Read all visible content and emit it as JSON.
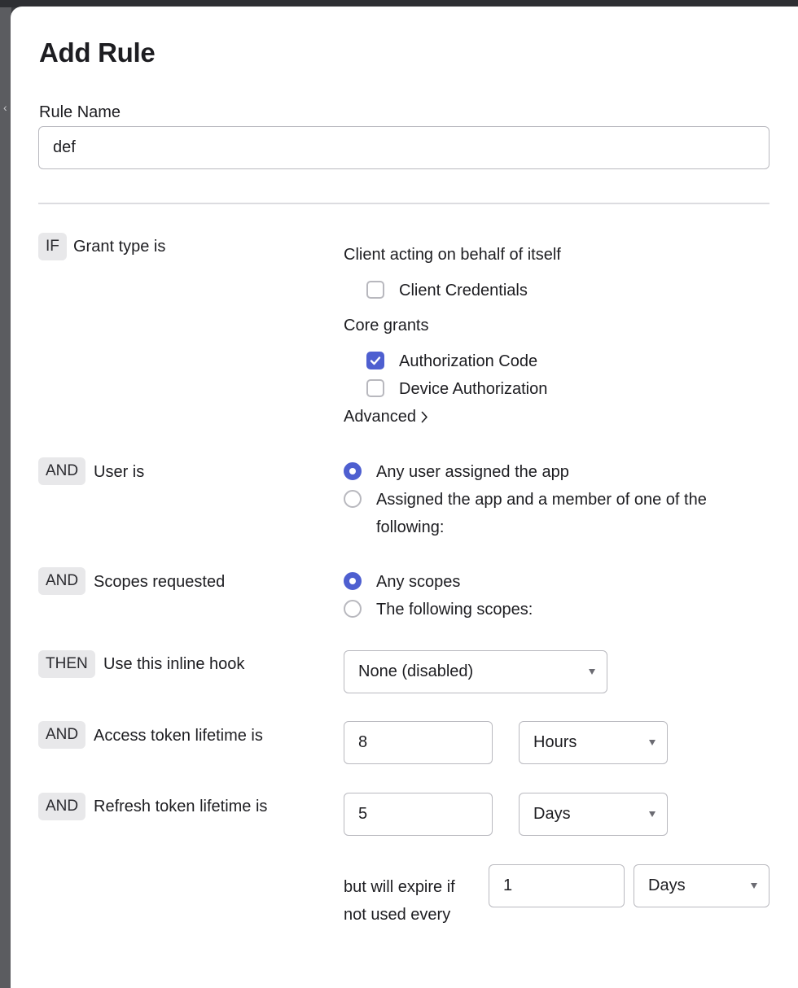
{
  "dialog": {
    "title": "Add Rule",
    "rule_name_label": "Rule Name",
    "rule_name_value": "def"
  },
  "grant": {
    "tag": "IF",
    "label": "Grant type is",
    "client_section": "Client acting on behalf of itself",
    "client_credentials": {
      "label": "Client Credentials",
      "checked": false
    },
    "core_section": "Core grants",
    "authorization_code": {
      "label": "Authorization Code",
      "checked": true
    },
    "device_authorization": {
      "label": "Device Authorization",
      "checked": false
    },
    "advanced_label": "Advanced"
  },
  "user": {
    "tag": "AND",
    "label": "User is",
    "option_any": "Any user assigned the app",
    "option_member_line1": "Assigned the app and a member of one of the",
    "option_member_line2": "following:",
    "selected": "any"
  },
  "scopes": {
    "tag": "AND",
    "label": "Scopes requested",
    "option_any": "Any scopes",
    "option_following": "The following scopes:",
    "selected": "any"
  },
  "hook": {
    "tag": "THEN",
    "label": "Use this inline hook",
    "selected": "None (disabled)"
  },
  "access_token": {
    "tag": "AND",
    "label": "Access token lifetime is",
    "value": "8",
    "unit": "Hours"
  },
  "refresh_token": {
    "tag": "AND",
    "label": "Refresh token lifetime is",
    "value": "5",
    "unit": "Days",
    "expire_line1": "but will expire if",
    "expire_line2": "not used every",
    "expire_value": "1",
    "expire_unit": "Days"
  },
  "colors": {
    "accent": "#4e5fd0",
    "tag_bg": "#e8e8ea",
    "border": "#b9b9bf"
  },
  "icons": {
    "check": "check-icon",
    "chevron_right": "chevron-right-icon",
    "caret_down": "caret-down-icon"
  }
}
